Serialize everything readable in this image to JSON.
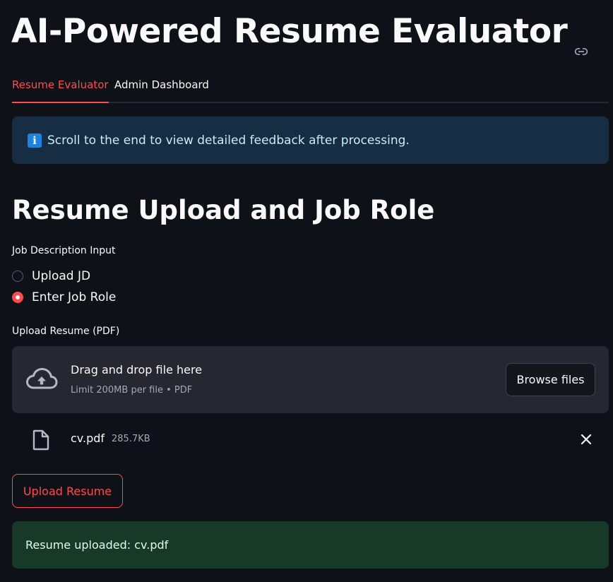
{
  "app": {
    "title": "AI-Powered Resume Evaluator",
    "accent_color": "#ff4b4b",
    "background_color": "#0e1117"
  },
  "tabs": [
    {
      "label": "Resume Evaluator",
      "active": true
    },
    {
      "label": "Admin Dashboard",
      "active": false
    }
  ],
  "info_banner": {
    "icon": "info-icon",
    "icon_glyph": "i",
    "text": "Scroll to the end to view detailed feedback after processing."
  },
  "section": {
    "heading": "Resume Upload and Job Role"
  },
  "job_description": {
    "label": "Job Description Input",
    "options": [
      {
        "label": "Upload JD",
        "selected": false
      },
      {
        "label": "Enter Job Role",
        "selected": true
      }
    ]
  },
  "resume_upload": {
    "label": "Upload Resume (PDF)",
    "dropzone_title": "Drag and drop file here",
    "dropzone_limit": "Limit 200MB per file • PDF",
    "browse_label": "Browse files",
    "icon": "cloud-upload-icon",
    "file": {
      "name": "cv.pdf",
      "size": "285.7KB",
      "icon": "file-icon"
    }
  },
  "actions": {
    "upload_label": "Upload Resume"
  },
  "success_banner": {
    "text": "Resume uploaded: cv.pdf"
  }
}
